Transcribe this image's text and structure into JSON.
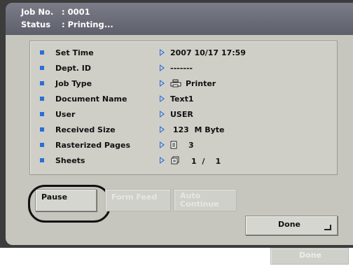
{
  "header": {
    "job_no_label": "Job No.",
    "job_no_value": ": 0001",
    "status_label": "Status",
    "status_value": ": Printing..."
  },
  "details": [
    {
      "label": "Set Time",
      "value": "2007 10/17 17:59",
      "icon": ""
    },
    {
      "label": "Dept. ID",
      "value": "-------",
      "icon": ""
    },
    {
      "label": "Job Type",
      "value": "Printer",
      "icon": "printer-icon"
    },
    {
      "label": "Document Name",
      "value": "Text1",
      "icon": ""
    },
    {
      "label": "User",
      "value": "USER",
      "icon": ""
    },
    {
      "label": "Received Size",
      "value": " 123  M Byte",
      "icon": ""
    },
    {
      "label": "Rasterized Pages",
      "value": "3",
      "icon": "page-icon"
    },
    {
      "label": "Sheets",
      "value": "1  /    1",
      "icon": "sheets-icon"
    }
  ],
  "buttons": {
    "pause": "Pause",
    "form_feed": "Form Feed",
    "auto_continue_line1": "Auto",
    "auto_continue_line2": "Continue",
    "done": "Done",
    "done_bottom": "Done"
  },
  "colors": {
    "accent": "#2a6fd6",
    "header": "#5d606b",
    "background": "#c6c6be"
  }
}
